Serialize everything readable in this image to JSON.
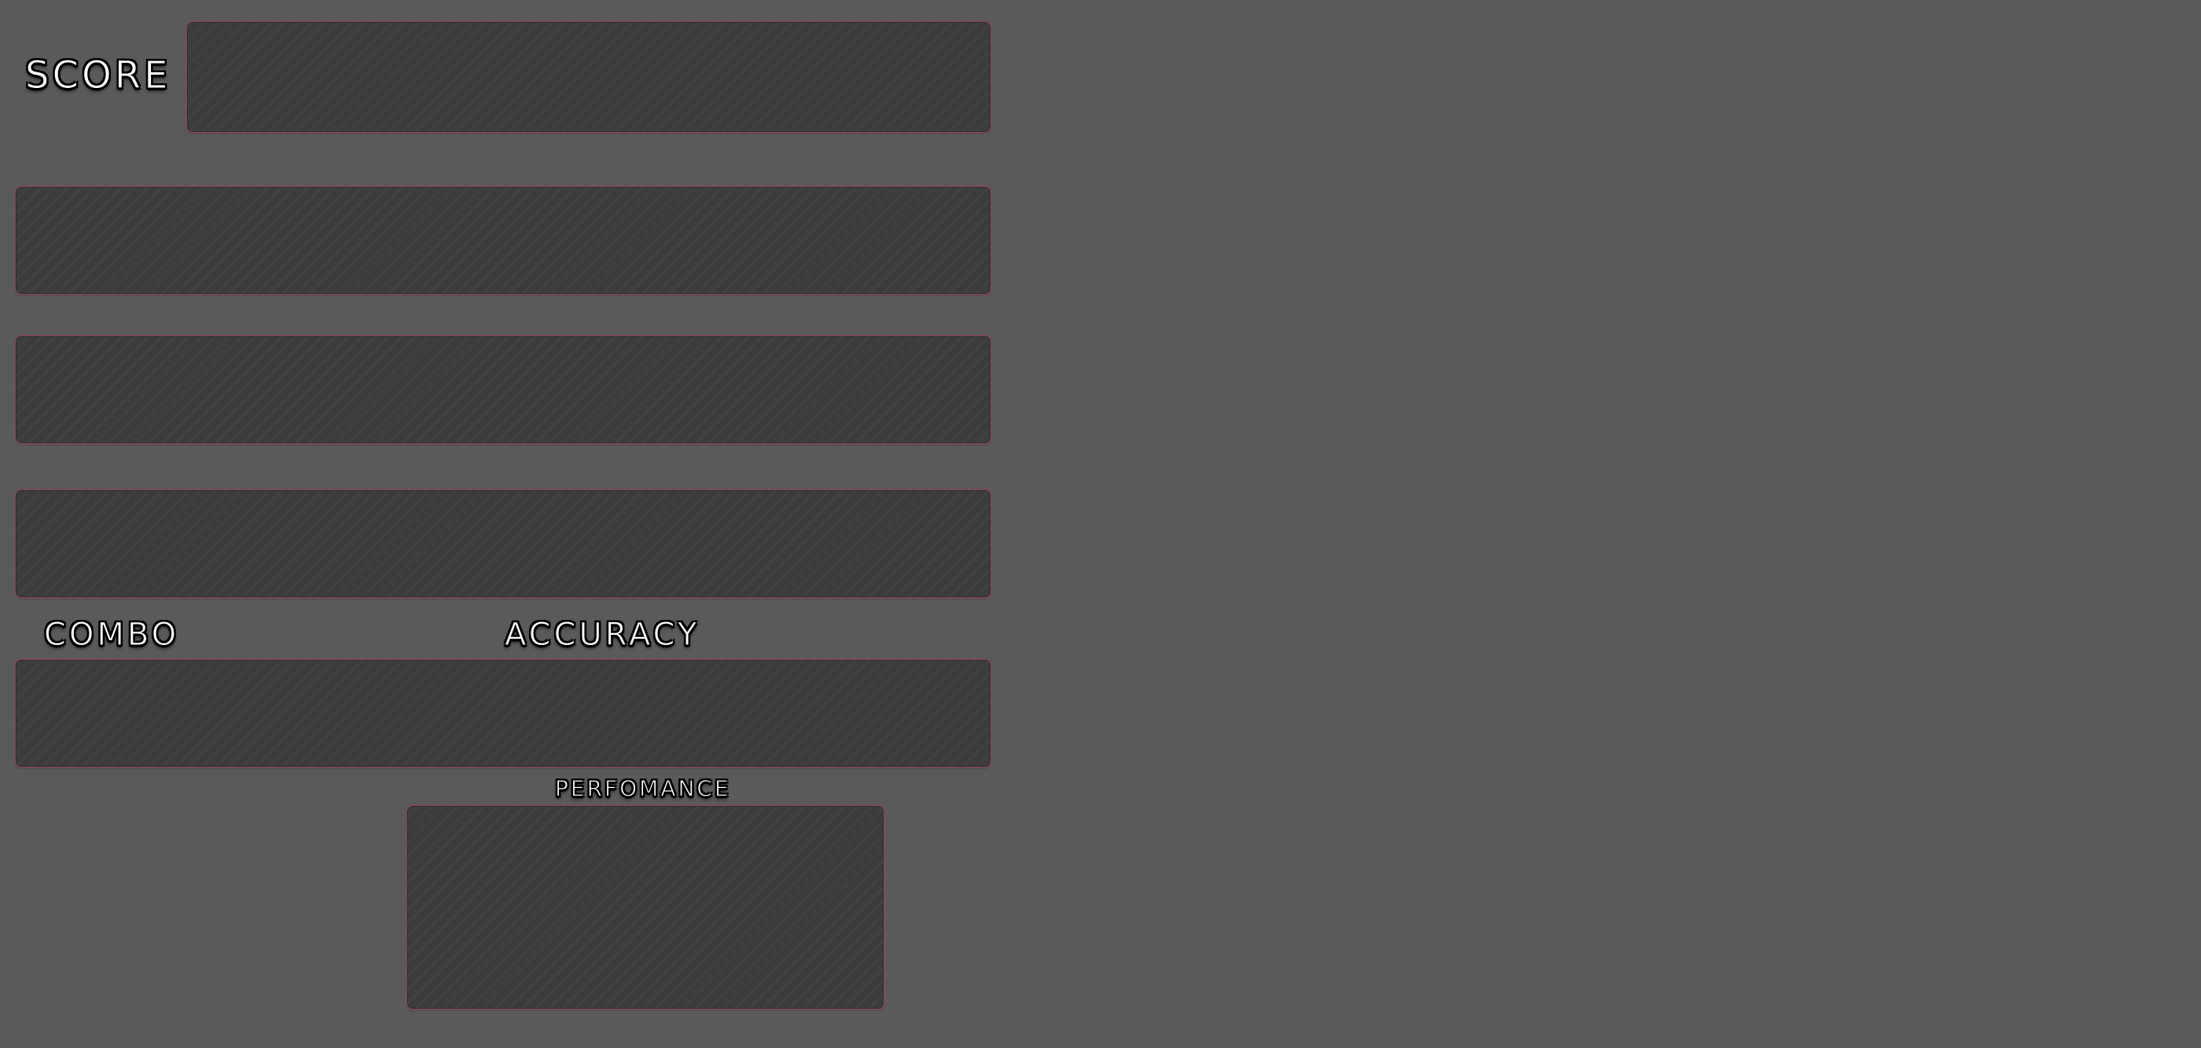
{
  "hud": {
    "score_label": "SCORE",
    "combo_label": "COMBO",
    "accuracy_label": "ACCURACY",
    "performance_label": "PERFOMANCE"
  },
  "colors": {
    "background": "#5a5a5a",
    "panel_fill": "#3c3c3c",
    "panel_border": "#7b4a5a",
    "label_text": "#ffffff",
    "label_outline": "#000000"
  }
}
